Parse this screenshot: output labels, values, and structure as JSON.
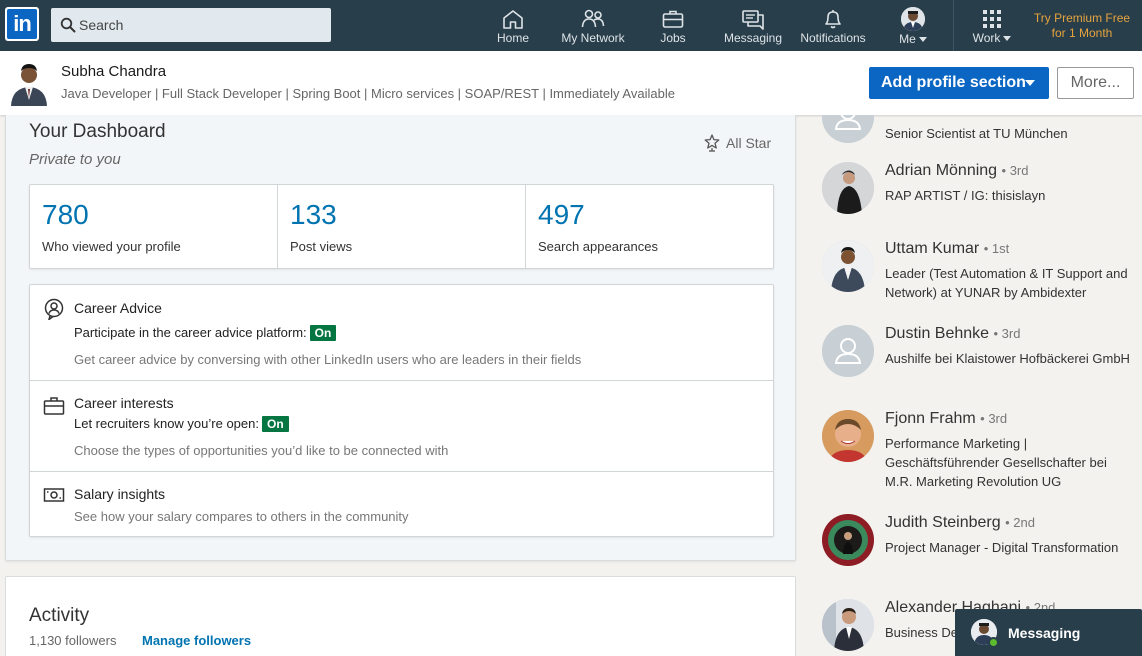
{
  "nav": {
    "search_placeholder": "Search",
    "items": [
      {
        "label": "Home",
        "icon": "home-icon"
      },
      {
        "label": "My Network",
        "icon": "network-icon"
      },
      {
        "label": "Jobs",
        "icon": "briefcase-icon"
      },
      {
        "label": "Messaging",
        "icon": "messaging-icon"
      },
      {
        "label": "Notifications",
        "icon": "bell-icon"
      },
      {
        "label": "Me",
        "icon": "avatar"
      },
      {
        "label": "Work",
        "icon": "grid-icon"
      }
    ],
    "premium_line1": "Try Premium Free",
    "premium_line2": "for 1 Month"
  },
  "profile": {
    "name": "Subha Chandra",
    "headline": "Java Developer | Full Stack Developer | Spring Boot | Micro services | SOAP/REST | Immediately Available",
    "add_section_label": "Add profile section",
    "more_label": "More..."
  },
  "dashboard": {
    "title": "Your Dashboard",
    "subtitle": "Private to you",
    "all_star_label": "All Star",
    "stats": [
      {
        "value": "780",
        "label": "Who viewed your profile"
      },
      {
        "value": "133",
        "label": "Post views"
      },
      {
        "value": "497",
        "label": "Search appearances"
      }
    ],
    "career_advice": {
      "title": "Career Advice",
      "line": "Participate in the career advice platform:",
      "badge": "On",
      "description": "Get career advice by conversing with other LinkedIn users who are leaders in their fields"
    },
    "career_interests": {
      "title": "Career interests",
      "line": "Let recruiters know you’re open:",
      "badge": "On",
      "description": "Choose the types of opportunities you’d like to be connected with"
    },
    "salary_insights": {
      "title": "Salary insights",
      "description": "See how your salary compares to others in the community"
    }
  },
  "activity": {
    "title": "Activity",
    "followers": "1,130 followers",
    "manage_label": "Manage followers"
  },
  "people": [
    {
      "name": "",
      "degree": "",
      "title": "Senior Scientist at TU München"
    },
    {
      "name": "Adrian Mönning",
      "degree": "• 3rd",
      "title": "RAP ARTIST / IG: thisislayn"
    },
    {
      "name": "Uttam Kumar",
      "degree": "• 1st",
      "title": "Leader (Test Automation & IT Support and Network) at YUNAR by Ambidexter"
    },
    {
      "name": "Dustin Behnke",
      "degree": "• 3rd",
      "title": "Aushilfe bei Klaistower Hofbäckerei GmbH"
    },
    {
      "name": "Fjonn Frahm",
      "degree": "• 3rd",
      "title": "Performance Marketing | Geschäftsführender Gesellschafter bei M.R. Marketing Revolution UG"
    },
    {
      "name": "Judith Steinberg",
      "degree": "• 2nd",
      "title": "Project Manager - Digital Transformation"
    },
    {
      "name": "Alexander Haghani",
      "degree": "• 2nd",
      "title": "Business Development Germany at"
    }
  ],
  "messaging_tab": {
    "label": "Messaging"
  },
  "colors": {
    "nav_bg": "#283e4a",
    "primary_blue": "#0a66c2",
    "link_blue": "#0073b1",
    "on_badge": "#057642",
    "premium_gold": "#e7a33e",
    "online_dot": "#5dbb2e"
  }
}
